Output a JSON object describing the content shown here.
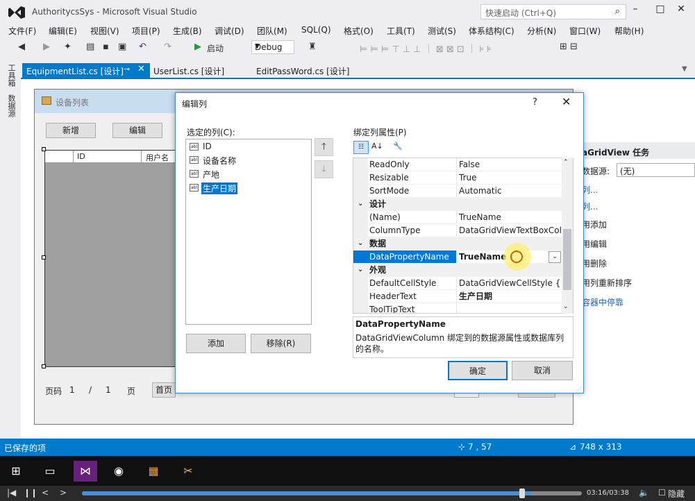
{
  "window": {
    "title": "AuthoritycsSys - Microsoft Visual Studio",
    "quick_launch_placeholder": "快速启动 (Ctrl+Q)",
    "minimize": "–",
    "maximize": "□",
    "close": "✕"
  },
  "menu": [
    "文件(F)",
    "编辑(E)",
    "视图(V)",
    "项目(P)",
    "生成(B)",
    "调试(D)",
    "团队(M)",
    "SQL(Q)",
    "格式(O)",
    "工具(T)",
    "测试(S)",
    "体系结构(C)",
    "分析(N)",
    "窗口(W)",
    "帮助(H)"
  ],
  "toolbar": {
    "start_label": "启动",
    "config": "Debug"
  },
  "side_tabs": [
    "工具箱",
    "数据源"
  ],
  "tabs": {
    "active": "EquipmentList.cs [设计]",
    "tab2": "UserList.cs [设计]",
    "tab3": "EditPassWord.cs [设计]"
  },
  "form": {
    "title": "设备列表",
    "add_button": "新增",
    "edit_button": "编辑",
    "grid_headers": [
      "ID",
      "用户名"
    ],
    "pager": {
      "page_label": "页码",
      "current": "1",
      "sep": "/",
      "total": "1",
      "page_suffix": "页",
      "first_button": "首页"
    }
  },
  "tasks_panel": {
    "title": "aGridView 任务",
    "datasource_label": "数据源:",
    "datasource_value": "(无)",
    "items": [
      "列...",
      "列...",
      "用添加",
      "用编辑",
      "用删除",
      "用列重新排序",
      "容器中停靠"
    ]
  },
  "dialog": {
    "title": "编辑列",
    "help": "?",
    "close": "✕",
    "selected_columns_label": "选定的列(C):",
    "columns": [
      "ID",
      "设备名称",
      "产地",
      "生产日期"
    ],
    "selected_index": 3,
    "add_button": "添加",
    "remove_button": "移除(R)",
    "bound_props_label": "绑定列属性(P)",
    "properties": {
      "rows_top": [
        {
          "name": "ReadOnly",
          "value": "False"
        },
        {
          "name": "Resizable",
          "value": "True"
        },
        {
          "name": "SortMode",
          "value": "Automatic"
        }
      ],
      "cat_design": "设计",
      "rows_design": [
        {
          "name": "(Name)",
          "value": "TrueName"
        },
        {
          "name": "ColumnType",
          "value": "DataGridViewTextBoxColu"
        }
      ],
      "cat_data": "数据",
      "rows_data": [
        {
          "name": "DataPropertyName",
          "value": "TrueName"
        }
      ],
      "cat_appearance": "外观",
      "rows_appearance": [
        {
          "name": "DefaultCellStyle",
          "value": "DataGridViewCellStyle { }"
        },
        {
          "name": "HeaderText",
          "value": "生产日期"
        },
        {
          "name": "ToolTipText",
          "value": ""
        }
      ]
    },
    "description_title": "DataPropertyName",
    "description_text": "DataGridViewColumn 绑定到的数据源属性或数据库列的名称。",
    "ok_button": "确定",
    "cancel_button": "取消"
  },
  "status": {
    "left": "已保存的项",
    "position": "7 , 57",
    "size": "748 x 313"
  },
  "player": {
    "time": "03:16/03:38",
    "hide": "隐藏",
    "progress": 0.9
  },
  "colors": {
    "accent": "#007acc",
    "selection": "#0078d7"
  }
}
